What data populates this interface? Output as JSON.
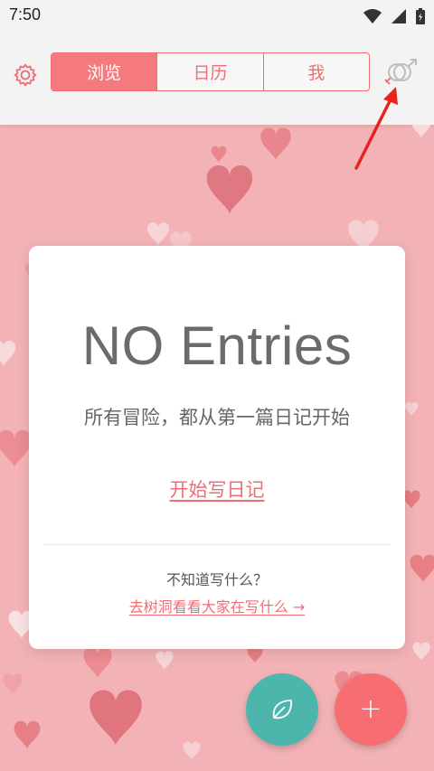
{
  "status_bar": {
    "time": "7:50",
    "icons": [
      "wifi-icon",
      "signal-icon",
      "battery-icon"
    ]
  },
  "header": {
    "tabs": [
      {
        "label": "浏览",
        "active": true
      },
      {
        "label": "日历",
        "active": false
      },
      {
        "label": "我",
        "active": false
      }
    ],
    "left_icon": "settings-gear-icon",
    "right_icon": "gender-icon"
  },
  "card": {
    "title": "NO Entries",
    "subtitle": "所有冒险，都从第一篇日记开始",
    "start_link": "开始写日记",
    "question": "不知道写什么？",
    "treehole_link": "去树洞看看大家在写什么 →"
  },
  "fabs": {
    "leaf_icon": "leaf-icon",
    "add_label": "+"
  },
  "colors": {
    "accent": "#ef6e75",
    "background": "#f3b3b6",
    "fab_leaf": "#4db6ac",
    "fab_add": "#f66e72"
  }
}
